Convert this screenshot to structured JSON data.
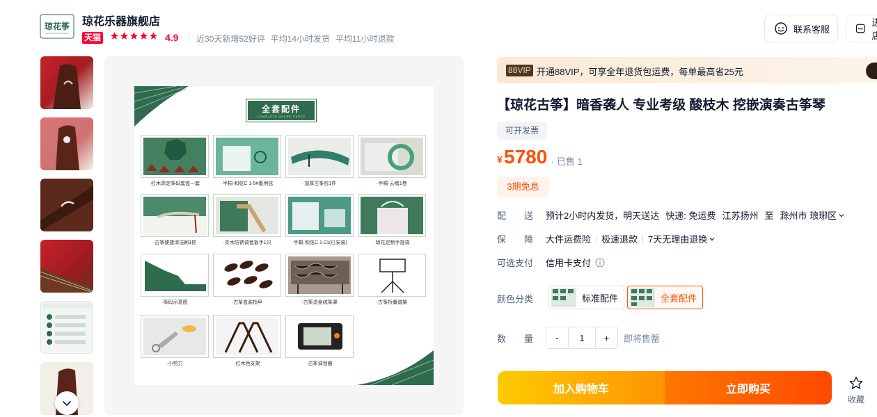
{
  "store": {
    "name": "琼花乐器旗舰店",
    "logo_text": "琼花筝",
    "badge": "天猫",
    "rating": "4.9",
    "stats": [
      "近30天新增52好评",
      "平均14小时发货",
      "平均11小时退款"
    ]
  },
  "header_buttons": {
    "service": "联系客服",
    "shop": "进店"
  },
  "poster": {
    "title": "全套配件",
    "subtitle": "COMPLETE SPARE PARTS",
    "captions": [
      "·红木高定筝码套盒一套",
      "·半桐·和弦C 1-5#备用弦",
      "·加厚古筝包1件",
      "·半桐·云缠1卷",
      "·古筝便捷清洁刷1把",
      "·实木防锈调音扳手1只",
      "·半桐·和弦C 1-21(已安装)",
      "·琼花定制手提袋",
      "·筝码示意图",
      "·古筝盒装指甲",
      "·古筝烫金绒筝罩",
      "·古筝折叠谱架",
      "·小剪刀",
      "·红木色支架",
      "·古筝调音器"
    ]
  },
  "vip": {
    "tag": "88VIP",
    "text": "开通88VIP，可享全年退货包运费，每单最高省25元"
  },
  "product": {
    "title": "【琼花古筝】暗香袭人 专业考级 酸枝木 挖嵌演奏古筝琴",
    "invoice": "可开发票",
    "currency": "¥",
    "price": "5780",
    "sold": "· 已售 1",
    "installment": "3期免息"
  },
  "delivery": {
    "label": "配　　送",
    "text": "预计2小时内发货，明天送达",
    "shipping": "快递: 免运费",
    "from": "江苏扬州",
    "to_word": "至",
    "to": "滁州市 琅琊区"
  },
  "guarantee": {
    "label": "保　　障",
    "items": [
      "大件运费险",
      "极速退款",
      "7天无理由退换"
    ]
  },
  "payment": {
    "label": "可选支付",
    "value": "信用卡支付"
  },
  "color": {
    "label": "颜色分类",
    "options": [
      "标准配件",
      "全套配件"
    ],
    "selected": "全套配件"
  },
  "quantity": {
    "label": "数　　量",
    "minus": "-",
    "value": "1",
    "plus": "+",
    "status": "即将售罄"
  },
  "actions": {
    "add_to_cart": "加入购物车",
    "buy_now": "立即购买",
    "favorite": "收藏"
  },
  "colors": {
    "accent": "#ff5000",
    "tmall": "#ff0036"
  }
}
